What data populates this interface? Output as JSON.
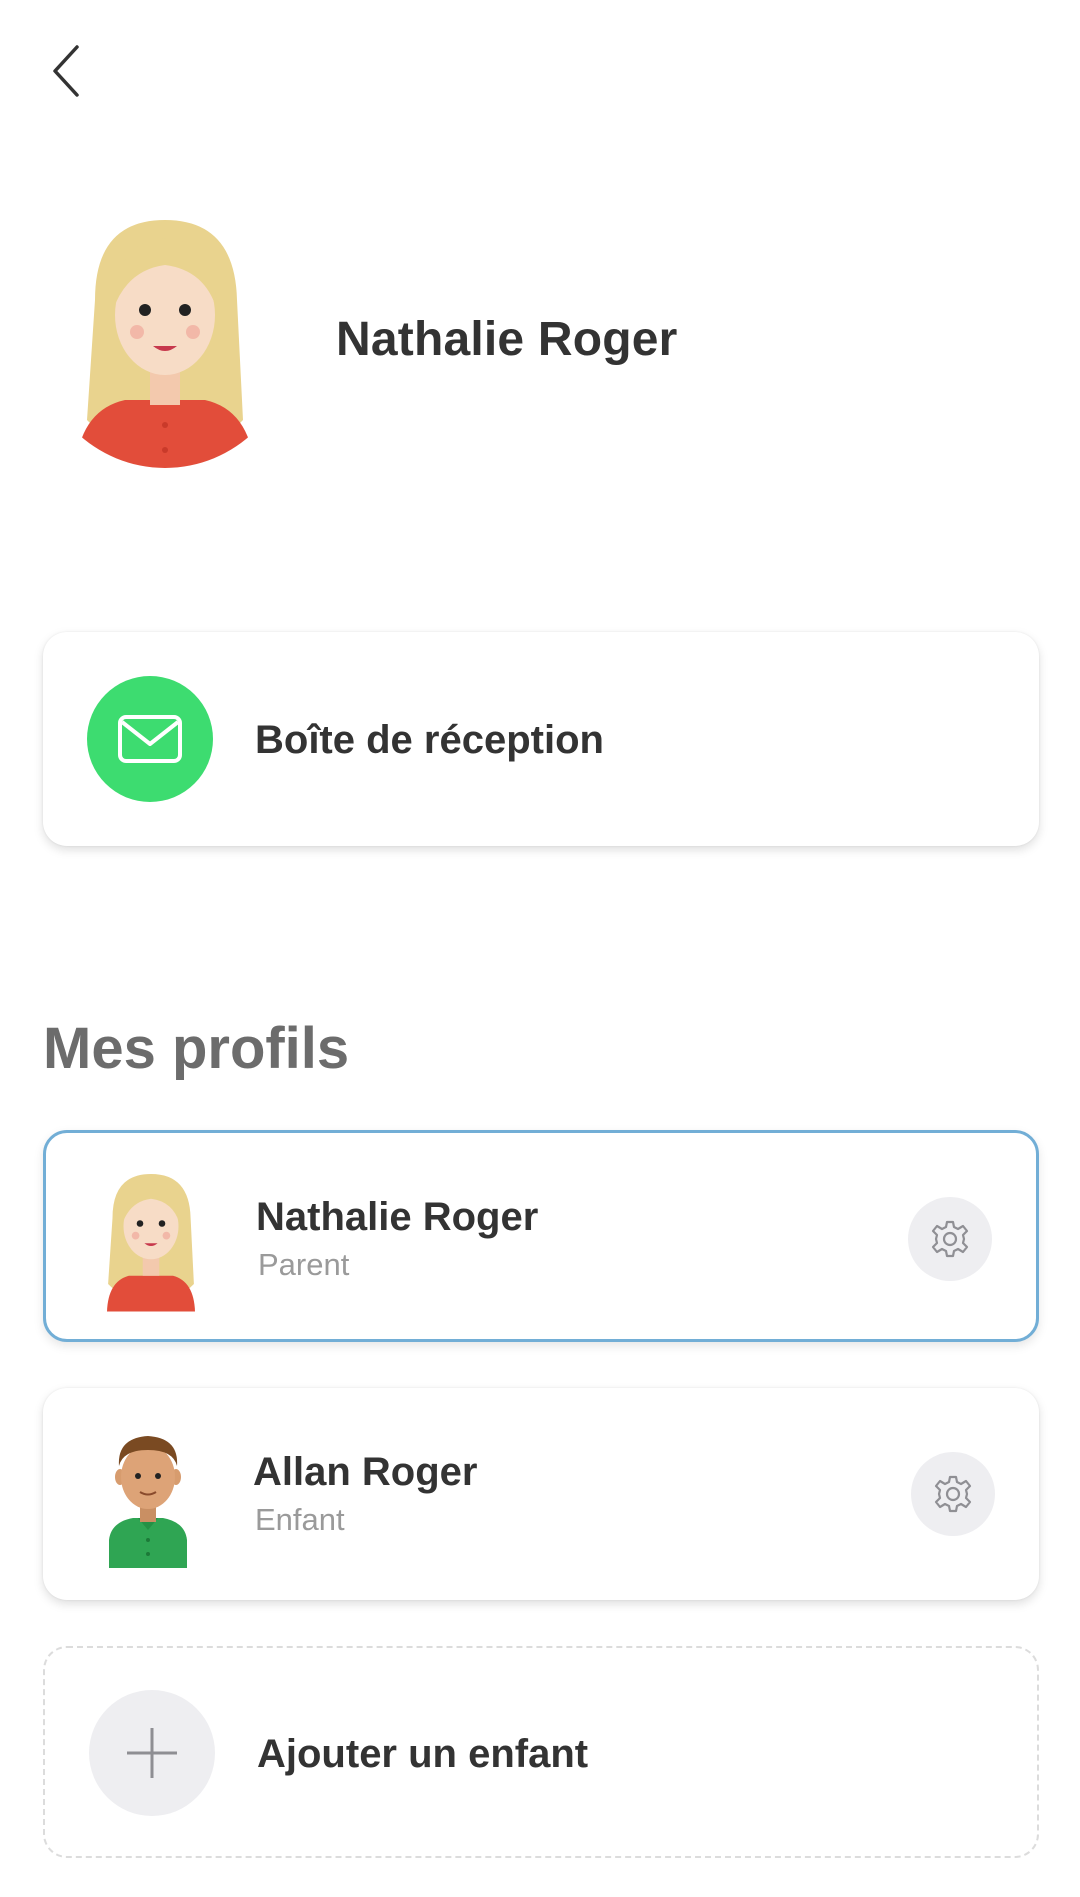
{
  "header": {
    "name": "Nathalie Roger",
    "avatar": "woman-avatar"
  },
  "inbox": {
    "label": "Boîte de réception",
    "icon": "mail-icon",
    "accent_color": "#3ddc70"
  },
  "profiles_section": {
    "title": "Mes profils",
    "items": [
      {
        "name": "Nathalie Roger",
        "role": "Parent",
        "avatar": "woman-avatar",
        "selected": true
      },
      {
        "name": "Allan Roger",
        "role": "Enfant",
        "avatar": "boy-avatar",
        "selected": false
      }
    ],
    "selected_border_color": "#72aed6"
  },
  "add_child": {
    "label": "Ajouter un enfant",
    "icon": "plus-icon"
  }
}
